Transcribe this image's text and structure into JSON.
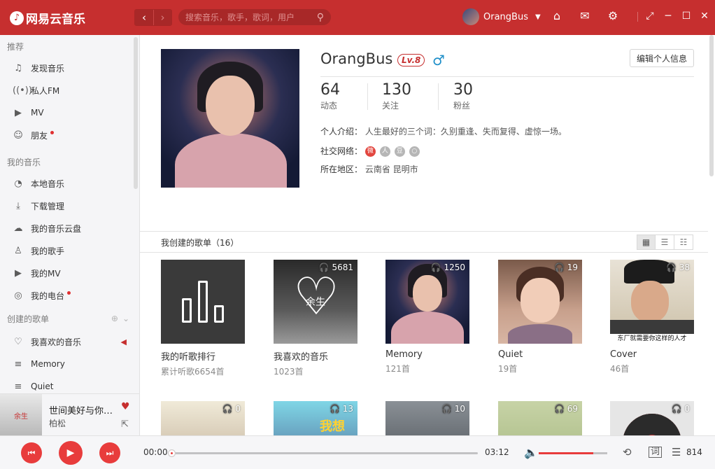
{
  "topbar": {
    "app_name": "网易云音乐",
    "search_placeholder": "搜索音乐，歌手，歌词，用户",
    "username": "OrangBus"
  },
  "sidebar": {
    "sections": [
      {
        "title": "推荐",
        "items": [
          {
            "label": "发现音乐",
            "icon": "music-note-icon"
          },
          {
            "label": "私人FM",
            "icon": "radio-icon"
          },
          {
            "label": "MV",
            "icon": "mv-icon"
          },
          {
            "label": "朋友",
            "icon": "friends-icon",
            "dot": true
          }
        ]
      },
      {
        "title": "我的音乐",
        "items": [
          {
            "label": "本地音乐",
            "icon": "local-music-icon"
          },
          {
            "label": "下载管理",
            "icon": "download-icon"
          },
          {
            "label": "我的音乐云盘",
            "icon": "cloud-icon"
          },
          {
            "label": "我的歌手",
            "icon": "singer-icon"
          },
          {
            "label": "我的MV",
            "icon": "mv-icon"
          },
          {
            "label": "我的电台",
            "icon": "station-icon",
            "dot": true
          }
        ]
      }
    ],
    "created_title": "创建的歌单",
    "created_items": [
      {
        "label": "我喜欢的音乐",
        "icon": "heart-icon"
      },
      {
        "label": "Memory",
        "icon": "playlist-icon"
      },
      {
        "label": "Quiet",
        "icon": "playlist-icon"
      }
    ]
  },
  "now_playing": {
    "title": "世间美好与你环环相扣",
    "artist": "柏松"
  },
  "profile": {
    "name": "OrangBus",
    "level": "Lv.8",
    "edit_label": "编辑个人信息",
    "stats": [
      {
        "value": "64",
        "label": "动态"
      },
      {
        "value": "130",
        "label": "关注"
      },
      {
        "value": "30",
        "label": "粉丝"
      }
    ],
    "bio_label": "个人介绍：",
    "bio": "人生最好的三个词：久别重逢、失而复得、虚惊一场。",
    "social_label": "社交网络：",
    "region_label": "所在地区：",
    "region": "云南省 昆明市"
  },
  "playlists": {
    "header": "我创建的歌单（16）",
    "row1": [
      {
        "name": "我的听歌排行",
        "count": "累计听歌6654首",
        "plays": ""
      },
      {
        "name": "我喜欢的音乐",
        "count": "1023首",
        "plays": "5681"
      },
      {
        "name": "Memory",
        "count": "121首",
        "plays": "1250"
      },
      {
        "name": "Quiet",
        "count": "19首",
        "plays": "19"
      },
      {
        "name": "Cover",
        "count": "46首",
        "plays": "38"
      }
    ],
    "row2_plays": [
      "0",
      "13",
      "10",
      "69",
      "0"
    ],
    "cover_texts": {
      "yusheng": "余生",
      "cover_caption": "东厂就需要你这样的人才",
      "woxiang": "我想"
    }
  },
  "player": {
    "current": "00:00",
    "total": "03:12",
    "progress": 0,
    "volume": 0.8,
    "lyrics_label": "词",
    "queue_count": "814"
  },
  "colors": {
    "accent": "#c62f2f",
    "play_red": "#e83c3c"
  }
}
